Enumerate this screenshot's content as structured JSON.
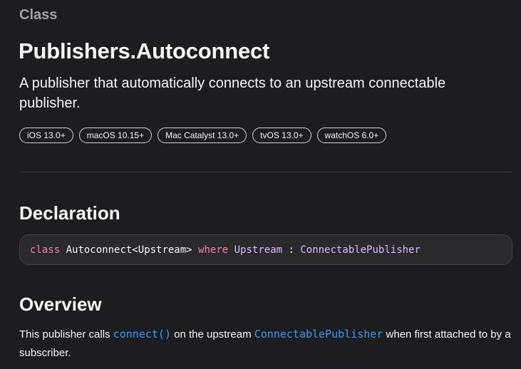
{
  "header": {
    "role": "Class",
    "title": "Publishers.Autoconnect",
    "abstract": "A publisher that automatically connects to an upstream connectable publisher."
  },
  "availability": [
    "iOS 13.0+",
    "macOS 10.15+",
    "Mac Catalyst 13.0+",
    "tvOS 13.0+",
    "watchOS 6.0+"
  ],
  "declaration": {
    "heading": "Declaration",
    "code": {
      "keyword_class": "class",
      "name": " Autoconnect<Upstream> ",
      "keyword_where": "where",
      "generic": " Upstream",
      "colon": " : ",
      "conformance": "ConnectablePublisher"
    }
  },
  "overview": {
    "heading": "Overview",
    "text_1": "This publisher calls ",
    "link_1": "connect()",
    "text_2": " on the upstream ",
    "link_2": "ConnectablePublisher",
    "text_3": " when first attached to by a subscriber."
  },
  "colors": {
    "background": "#1d1d1f",
    "link": "#3a9cff",
    "keyword": "#ff7ab2",
    "type_reference": "#dabaff"
  }
}
